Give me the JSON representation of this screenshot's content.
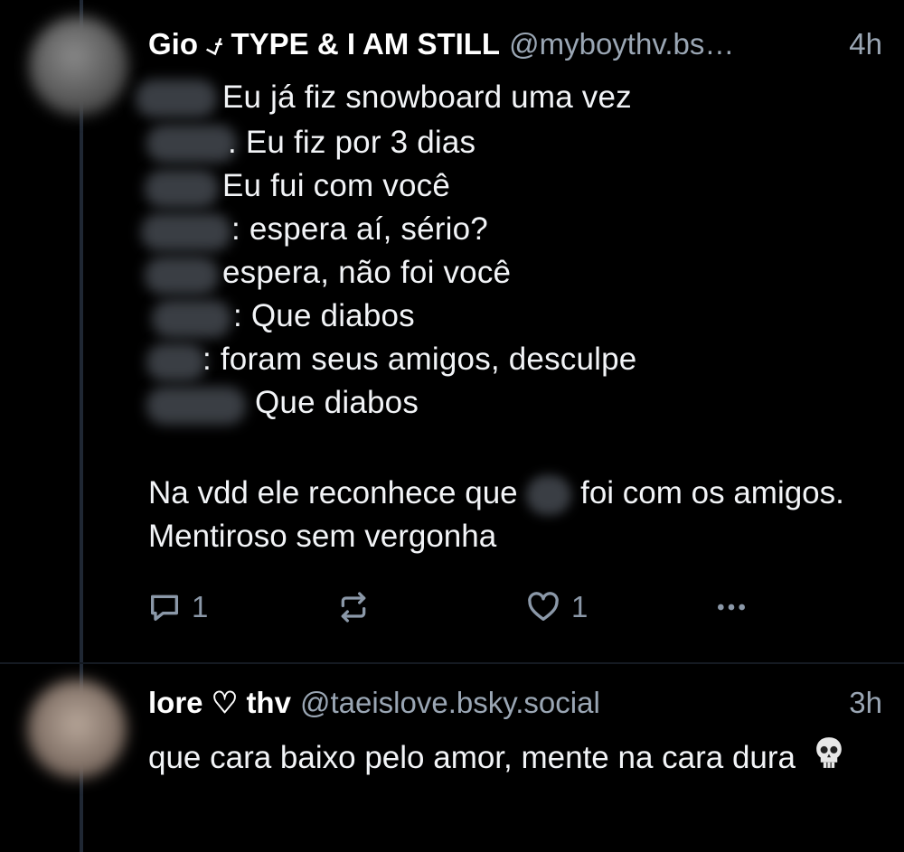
{
  "post1": {
    "author_name": "Gio ⍻ TYPE & I AM STILL",
    "handle": "@myboythv.bs…",
    "time": "4h",
    "lines": [
      "Eu já fiz snowboard uma vez",
      ". Eu fiz por 3 dias",
      "Eu fui com você",
      ": espera aí, sério?",
      "espera, não foi você",
      ": Que diabos",
      ": foram seus amigos, desculpe",
      "Que diabos"
    ],
    "body_part1": "Na vdd ele reconhece que",
    "body_part2": "foi com os amigos. Mentiroso sem vergonha",
    "reply_count": "1",
    "like_count": "1",
    "icons": {
      "reply": "reply-icon",
      "repost": "repost-icon",
      "like": "heart-icon",
      "more": "more-icon"
    }
  },
  "post2": {
    "author_name": "lore ♡ thv",
    "handle": "@taeislove.bsky.social",
    "time": "3h",
    "text": "que cara baixo pelo amor, mente na cara dura",
    "emoji_icon": "skull-icon"
  },
  "colors": {
    "background": "#000000",
    "text": "#f2f4f7",
    "muted": "#9aa6b4",
    "icon": "#8b98a8"
  }
}
